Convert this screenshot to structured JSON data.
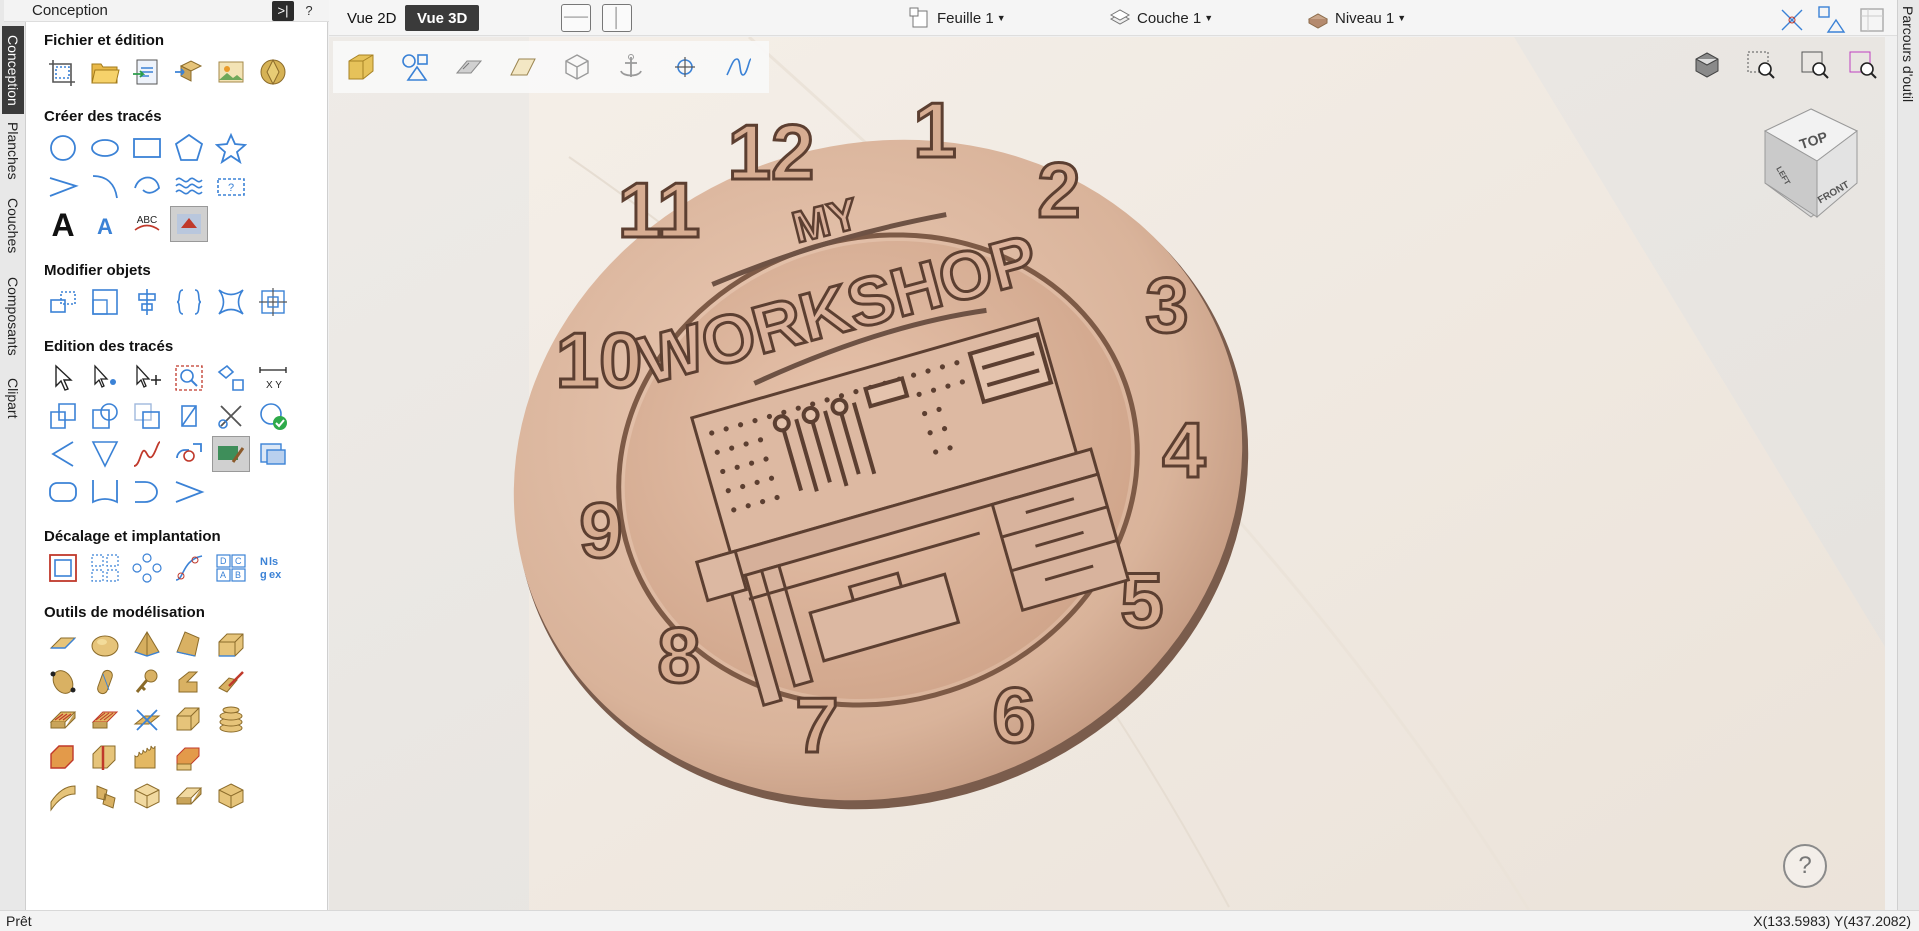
{
  "panel": {
    "title": "Conception",
    "vtabs": [
      "Conception",
      "Planches",
      "Couches",
      "Composants",
      "Clipart"
    ],
    "head_buttons": [
      ">|",
      "?",
      "⊥"
    ],
    "sections": {
      "file": "Fichier et édition",
      "create": "Créer des tracés",
      "modify": "Modifier objets",
      "edit": "Edition des tracés",
      "offset": "Décalage et implantation",
      "model": "Outils de modélisation"
    }
  },
  "toolbar": {
    "view2d": "Vue 2D",
    "view3d": "Vue 3D",
    "sheet": "Feuille 1",
    "layer": "Couche 1",
    "level": "Niveau 1"
  },
  "right_tab": "Parcours d'outil",
  "model": {
    "title_small": "MY",
    "title_big": "WORKSHOP",
    "numbers": [
      "12",
      "1",
      "2",
      "3",
      "4",
      "5",
      "6",
      "7",
      "8",
      "9",
      "10",
      "11"
    ]
  },
  "navcube": {
    "top": "TOP",
    "front": "FRONT",
    "left": "LEFT"
  },
  "help": "?",
  "status": {
    "ready": "Prêt",
    "coords": "X(133.5983) Y(437.2082)"
  },
  "colors": {
    "accent_blue": "#3b82d6",
    "wood": "#d9b39a",
    "model_shadow": "#6e5244"
  }
}
